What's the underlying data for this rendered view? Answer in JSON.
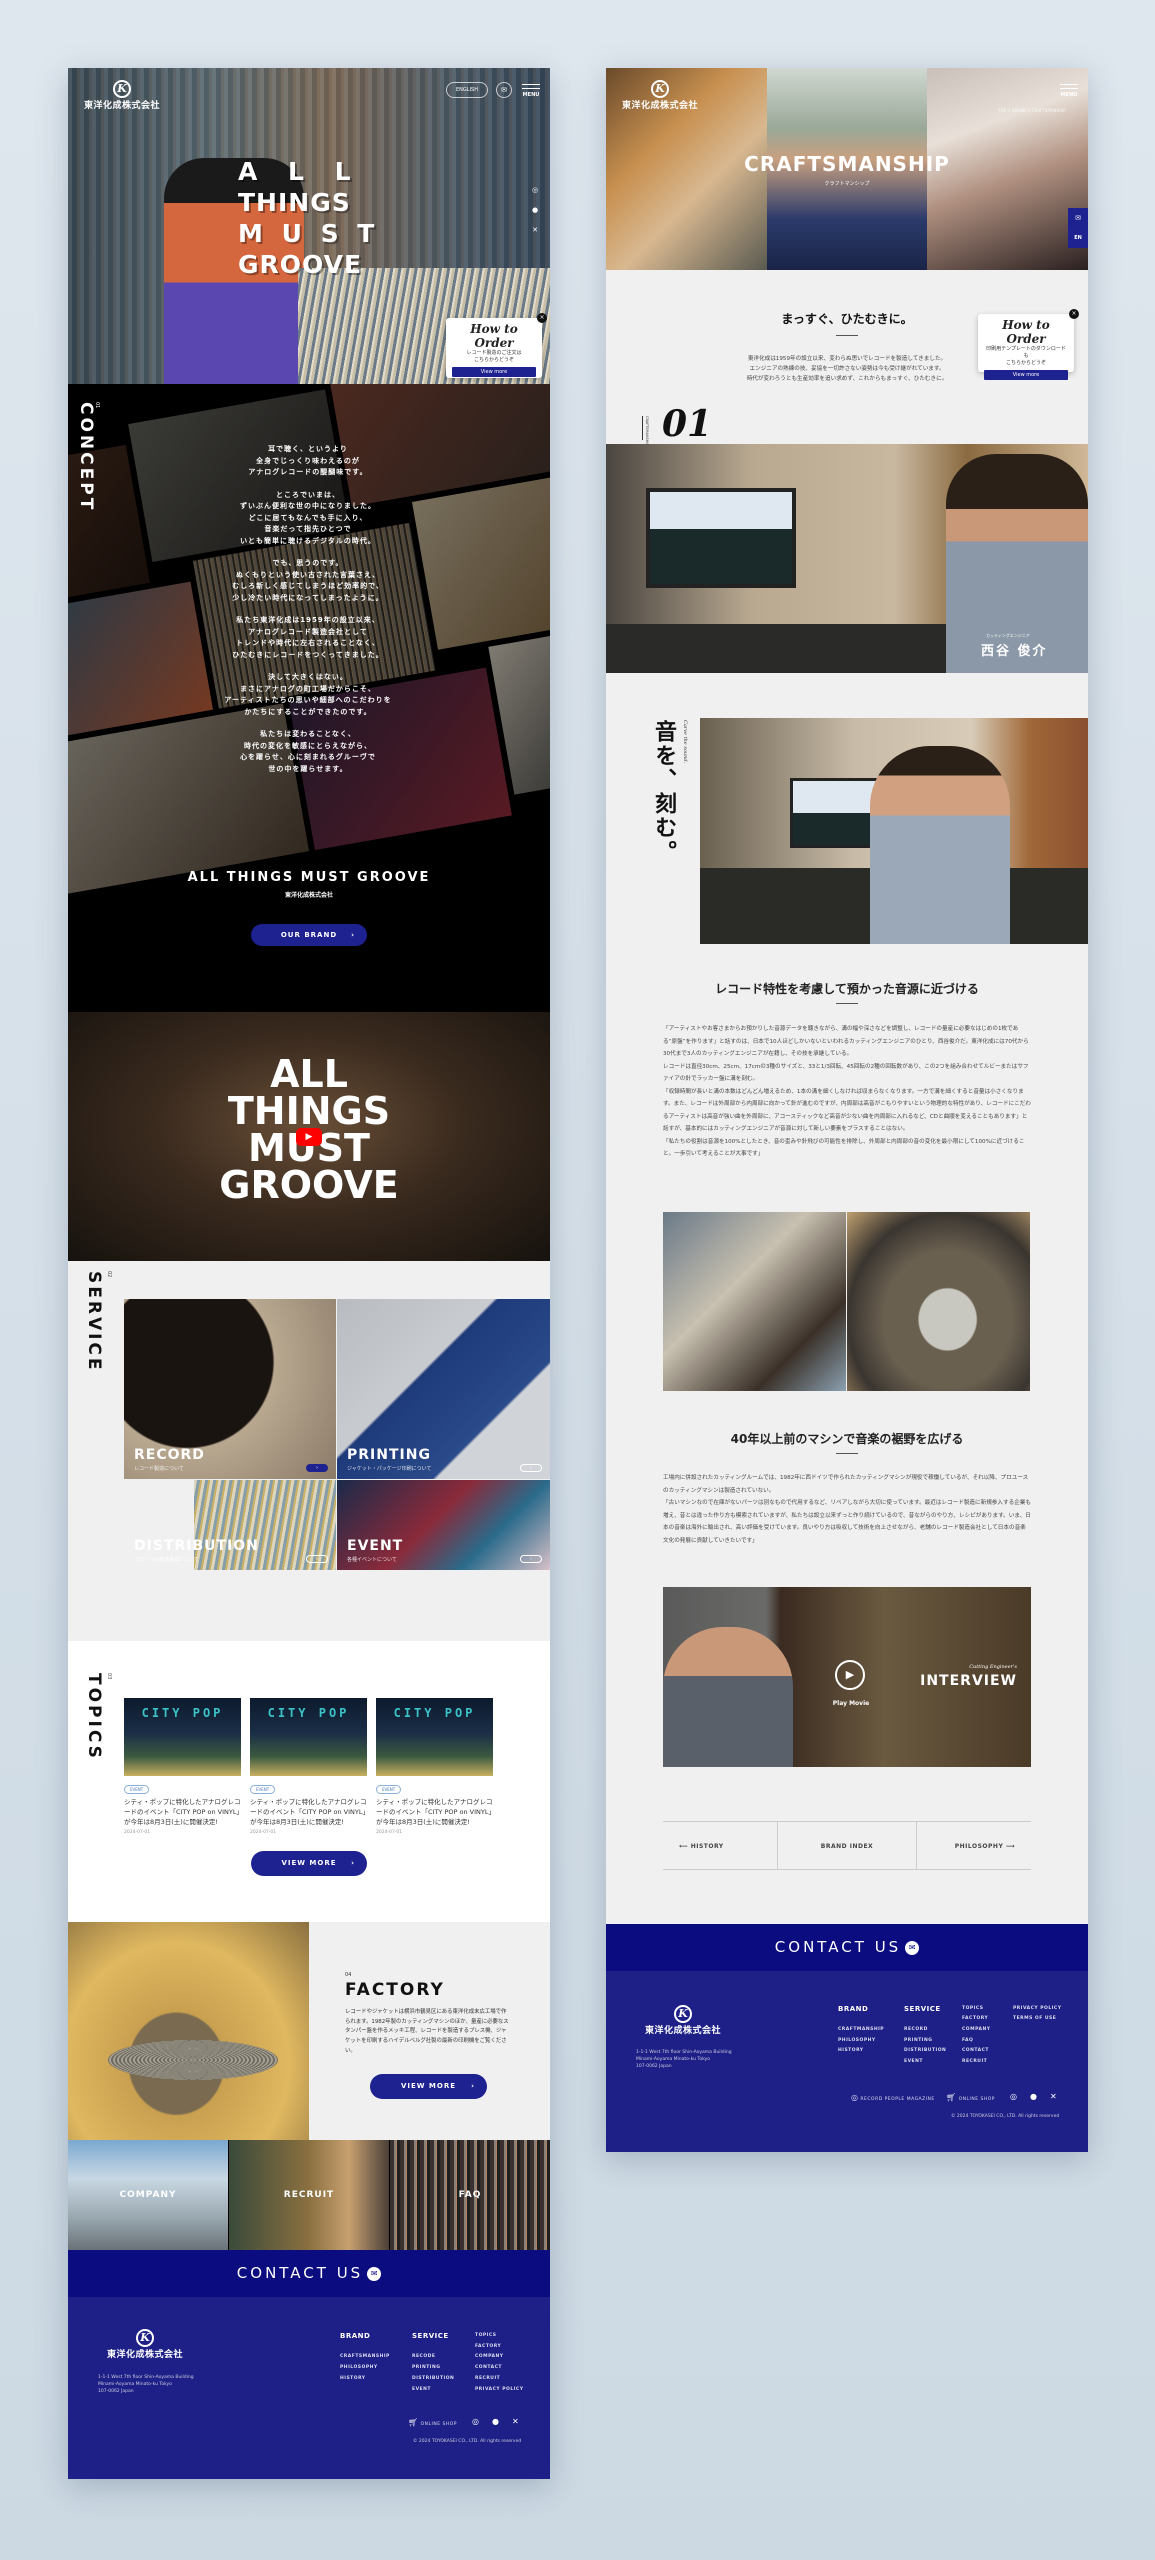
{
  "company_name": "東洋化成株式会社",
  "logo_letter": "K",
  "top_page": {
    "header": {
      "english_label": "ENGLISH",
      "menu_label": "MENU",
      "mail_icon": "mail-icon"
    },
    "hero": {
      "lines": [
        "A L L",
        "THINGS",
        "M U S T",
        "GROOVE"
      ],
      "social": [
        "instagram-icon",
        "facebook-icon",
        "x-icon"
      ]
    },
    "how_to_order": {
      "title": "How to Order",
      "text": [
        "レコード製造のご注文は",
        "こちらからどうぞ"
      ],
      "button": "View more"
    },
    "concept": {
      "number": "01",
      "title": "CONCEPT",
      "paragraphs": [
        [
          "耳で聴く、というより",
          "全身でじっくり味わえるのが",
          "アナログレコードの醍醐味です。"
        ],
        [
          "ところでいまは、",
          "ずいぶん便利な世の中になりました。",
          "どこに居てもなんでも手に入り、",
          "音楽だって指先ひとつで",
          "いとも簡単に聴けるデジタルの時代。"
        ],
        [
          "でも、思うのです。",
          "ぬくもりという使い古された言葉さえ、",
          "むしろ新しく感じてしまうほど効率的で、",
          "少し冷たい時代になってしまったように。"
        ],
        [
          "私たち東洋化成は1959年の設立以来、",
          "アナログレコード製造会社として",
          "トレンドや時代に左右されることなく、",
          "ひたむきにレコードをつくってきました。"
        ],
        [
          "決して大きくはない。",
          "まさにアナログの町工場だからこそ、",
          "アーティストたちの思いや細部へのこだわりを",
          "かたちにすることができたのです。"
        ],
        [
          "私たちは変わることなく、",
          "時代の変化を敏感にとらえながら、",
          "心を躍らせ、心に刻まれるグルーヴで",
          "世の中を躍らせます。"
        ]
      ],
      "slogan": "ALL THINGS MUST GROOVE",
      "company": "東洋化成株式会社",
      "button": "OUR BRAND"
    },
    "video": {
      "lines": [
        "ALL",
        "THINGS",
        "MUST",
        "GROOVE"
      ],
      "play_icon": "youtube-play-icon"
    },
    "service": {
      "number": "02",
      "title": "SERVICE",
      "items": [
        {
          "title": "RECORD",
          "subtitle": "レコード製造について"
        },
        {
          "title": "PRINTING",
          "subtitle": "ジャケット・パッケージ印刷について"
        },
        {
          "title": "DISTRIBUTION",
          "subtitle": "グローバル流通事業について"
        },
        {
          "title": "EVENT",
          "subtitle": "各種イベントについて"
        }
      ]
    },
    "topics": {
      "number": "03",
      "title": "TOPICS",
      "items": [
        {
          "image_text": "CITY POP",
          "tag": "EVENT",
          "title": "シティ・ポップに特化したアナログレコードのイベント「CITY POP on VINYL」が今年は8月3日(土)に開催決定!",
          "date": "2024-07-01"
        },
        {
          "image_text": "CITY POP",
          "tag": "EVENT",
          "title": "シティ・ポップに特化したアナログレコードのイベント「CITY POP on VINYL」が今年は8月3日(土)に開催決定!",
          "date": "2024-07-01"
        },
        {
          "image_text": "CITY POP",
          "tag": "EVENT",
          "title": "シティ・ポップに特化したアナログレコードのイベント「CITY POP on VINYL」が今年は8月3日(土)に開催決定!",
          "date": "2024-07-01"
        }
      ],
      "button": "VIEW MORE"
    },
    "factory": {
      "number": "04",
      "title": "FACTORY",
      "text": "レコードやジャケットは横浜市鶴見区にある東洋化成末広工場で作られます。1982年製のカッティングマシンのほか、量産に必要なスタンパー盤を作るメッキ工程、レコードを製造するプレス機、ジャケットを印刷するハイデルベルグ社製の最新の印刷機をご覧ください。",
      "button": "VIEW MORE"
    },
    "links": [
      "COMPANY",
      "RECRUIT",
      "FAQ"
    ],
    "contact": "CONTACT US",
    "footer": {
      "address": [
        "1-1-1 West 7th floor Shin-Aoyama Building",
        "Minami-Aoyama Minato-ku Tokyo",
        "107-0062 Japan"
      ],
      "brand": {
        "title": "BRAND",
        "items": [
          "CRAFTSMANSHIP",
          "PHILOSOPHY",
          "HISTORY"
        ]
      },
      "service": {
        "title": "SERVICE",
        "items": [
          "RECODE",
          "PRINTING",
          "DISTRIBUTION",
          "EVENT"
        ]
      },
      "other": [
        "TOPICS",
        "FACTORY",
        "COMPANY",
        "CONTACT",
        "RECRUIT",
        "PRIVACY POLICY"
      ],
      "online_shop": "ONLINE SHOP",
      "copyright": "© 2024 TOYOKASEI CO., LTD. All rights reserved"
    }
  },
  "craft_page": {
    "header": {
      "menu_label": "MENU",
      "breadcrumb": "TOP > BRAND > CRAFTSMANSHIP"
    },
    "hero": {
      "title": "CRAFTSMANSHIP",
      "subtitle": "クラフトマンシップ"
    },
    "side_tabs": {
      "mail_icon": "mail-icon",
      "en": "EN"
    },
    "intro": {
      "heading": "まっすぐ、ひたむきに。",
      "text": [
        "東洋化成は1959年の設立以来、変わらぬ思いでレコードを製造してきました。",
        "エンジニアの熟練の技、妥協を一切許さない姿勢は今も受け継がれています。",
        "時代が変わろうとも生産効率を追い求めず、これからもまっすぐ、ひたむきに。"
      ]
    },
    "how_to_order": {
      "title": "How to Order",
      "text": [
        "印刷用テンプレートのダウンロードも",
        "こちらからどうぞ"
      ],
      "button": "View more"
    },
    "section_label": "CRAFTSMANSHIP",
    "section_number": "01",
    "engineer": {
      "role": "カッティングエンジニア",
      "name": "西谷 俊介"
    },
    "vertical_title": "音を、刻む。",
    "vertical_sub": "Carve the sound.",
    "block1": {
      "heading": "レコード特性を考慮して預かった音源に近づける",
      "paragraphs": [
        "「アーティストやお客さまからお預かりした音源データを聴きながら、溝の幅や深さなどを調整し、レコードの量産に必要なはじめの1枚である“原盤”を作ります」と話すのは、日本で10人ほどしかいないといわれるカッティングエンジニアのひとり、西谷俊介だ。東洋化成には70代から30代まで3人のカッティングエンジニアが在籍し、その技を承継している。",
        "レコードは直径30cm、25cm、17cmの3種のサイズと、33と1/3回転、45回転の2種の回転数があり、この2つを組み合わせてルビーまたはサファイアの針でラッカー盤に溝を刻む。",
        "「収録時間が長いと溝の本数はどんどん増えるため、1本の溝を細くしなければ収まらなくなります。一方で溝を細くすると音量は小さくなります。また、レコードは外周部から内周部に向かって針が進むのですが、内周部は高音がこもりやすいという物理的な特性があり、レコードにこだわるアーティストは高音が強い曲を外周部に、アコースティックなど高音が少ない曲を内周部に入れるなど、CDと曲順を変えることもあります」と話すが、基本的にはカッティングエンジニアが音源に対して新しい要素をプラスすることはない。",
        "「私たちの役割は音源を100%としたとき、音の歪みや針飛びの可能性を排除し、外周部と内周部の音の変化を最小限にして100%に近づけること。一歩引いて考えることが大事です」"
      ]
    },
    "block2": {
      "heading": "40年以上前のマシンで音楽の裾野を広げる",
      "paragraphs": [
        "工場内に併設されたカッティングルームでは、1982年に西ドイツで作られたカッティングマシンが現役で稼働しているが、それ以降、プロユースのカッティングマシンは製造されていない。",
        "「古いマシンなので在庫がないパーツは別なもので代用するなど、リペアしながら大切に使っています。最近はレコード製造に新規参入する企業も増え、昔とは違った作り方も模索されていますが、私たちは設立以来ずっと作り続けているので、昔ながらのやり方、レシピがあります。いま、日本の音楽は海外に輸出され、高い評価を受けています。良いやり方は吸収して技術を向上させながら、老舗のレコード製造会社として日本の音楽文化の発展に貢献していきたいです」"
      ]
    },
    "interview": {
      "kicker": "Cutting Engineer's",
      "title": "INTERVIEW",
      "play_label": "Play Movie"
    },
    "pager": {
      "prev": "HISTORY",
      "index": "BRAND INDEX",
      "next": "PHILOSOPHY"
    },
    "contact": "CONTACT US",
    "footer": {
      "address": [
        "1-1-1 West 7th floor Shin-Aoyama Building",
        "Minami-Aoyama Minato-ku Tokyo",
        "107-0062 Japan"
      ],
      "brand": {
        "title": "BRAND",
        "items": [
          "CRAFTMANSHIP",
          "PHILOSOPHY",
          "HISTORY"
        ]
      },
      "service": {
        "title": "SERVICE",
        "items": [
          "RECORD",
          "PRINTING",
          "DISTRIBUTION",
          "EVENT"
        ]
      },
      "other": [
        "TOPICS",
        "FACTORY",
        "COMPANY",
        "FAQ",
        "CONTACT",
        "RECRUIT"
      ],
      "legal": [
        "PRIVACY POLICY",
        "TERMS OF USE"
      ],
      "magazine": "RECORD PEOPLE MAGAZINE",
      "online_shop": "ONLINE SHOP",
      "copyright": "© 2024 TOYOKASEI CO., LTD. All rights reserved"
    }
  },
  "colors": {
    "brand_navy": "#1e2190",
    "contact_bar": "#0a0c80",
    "footer": "#1e2088",
    "page_bg": "#d9e3ea",
    "youtube_red": "#ff0000"
  }
}
